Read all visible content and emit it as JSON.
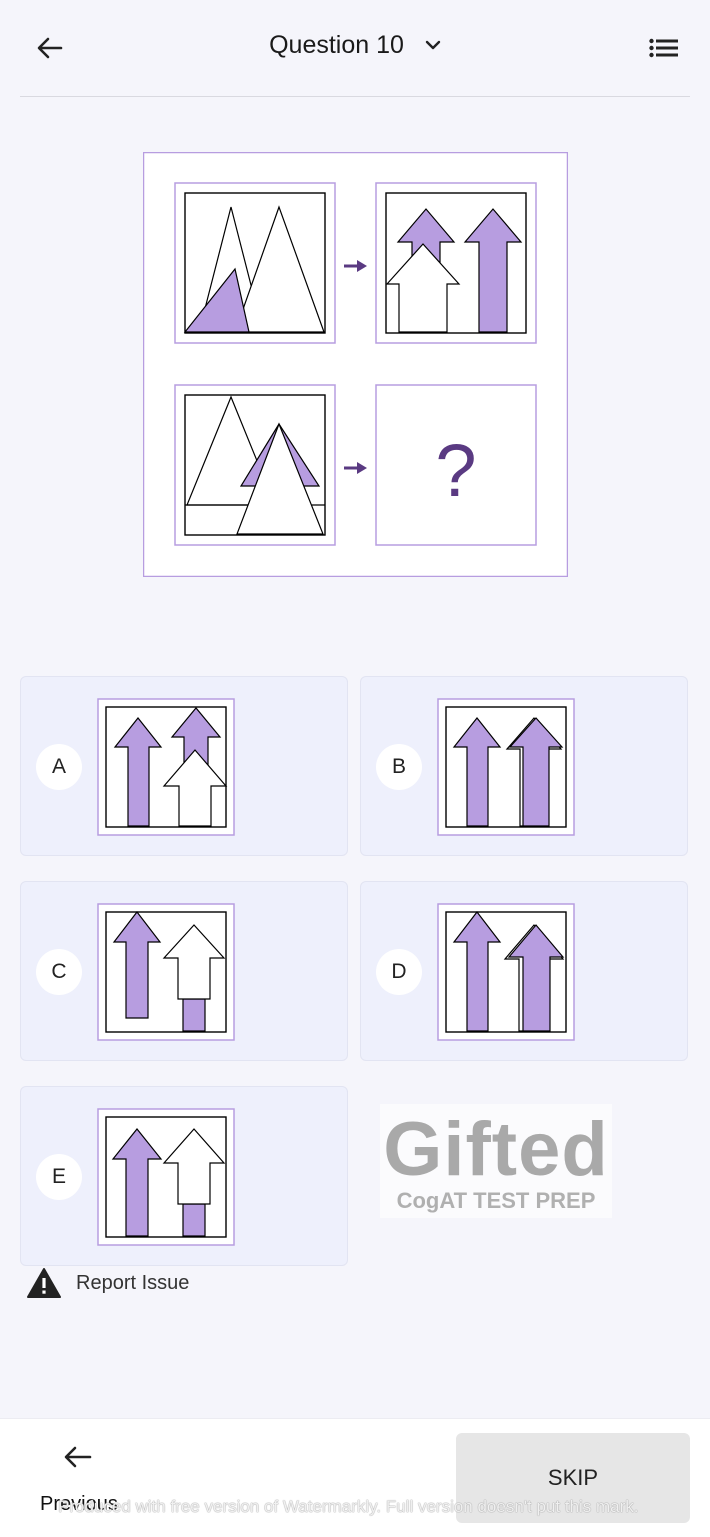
{
  "header": {
    "title": "Question 10",
    "back_icon": "arrow-left-icon",
    "dropdown_icon": "chevron-down-icon",
    "menu_icon": "list-icon"
  },
  "question": {
    "prompt_symbol": "?",
    "accent_color": "#b79de0",
    "border_color": "#b79de0",
    "arrow_color": "#5a3a82"
  },
  "options": [
    {
      "letter": "A"
    },
    {
      "letter": "B"
    },
    {
      "letter": "C"
    },
    {
      "letter": "D"
    },
    {
      "letter": "E"
    }
  ],
  "watermark_logo": {
    "title": "Gifted",
    "subtitle": "CogAT TEST PREP"
  },
  "report": {
    "label": "Report Issue",
    "icon": "warning-icon"
  },
  "footer": {
    "previous_label": "Previous",
    "skip_label": "SKIP",
    "watermark_text": "Produced with free version of Watermarkly. Full version doesn't put this mark."
  }
}
